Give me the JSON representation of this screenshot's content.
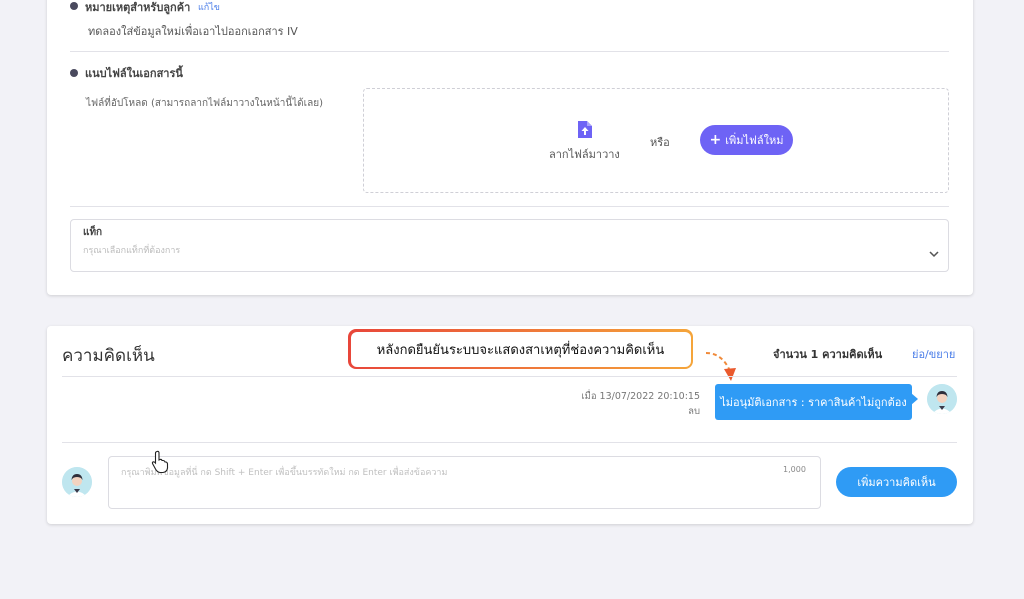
{
  "customer_note": {
    "title": "หมายเหตุสำหรับลูกค้า",
    "edit_label": "แก้ไข",
    "text": "ทดลองใส่ข้อมูลใหม่เพื่อเอาไปออกเอกสาร IV"
  },
  "attachments": {
    "title": "แนบไฟล์ในเอกสารนี้",
    "hint": "ไฟล์ที่อัปโหลด (สามารถลากไฟล์มาวางในหน้านี้ได้เลย)",
    "drag_label": "ลากไฟล์มาวาง",
    "or_label": "หรือ",
    "add_button": "เพิ่มไฟล์ใหม่"
  },
  "tag": {
    "label": "แท็ก",
    "placeholder": "กรุณาเลือกแท็กที่ต้องการ"
  },
  "comments": {
    "title": "ความคิดเห็น",
    "callout": "หลังกดยืนยันระบบจะแสดงสาเหตุที่ช่องความคิดเห็น",
    "count": "จำนวน 1 ความคิดเห็น",
    "collapse_label": "ย่อ/ขยาย",
    "items": [
      {
        "timestamp": "เมื่อ 13/07/2022 20:10:15",
        "delete_label": "ลบ",
        "message": "ไม่อนุมัติเอกสาร : ราคาสินค้าไม่ถูกต้อง"
      }
    ],
    "input_placeholder": "กรุณาพิมพ์ข้อมูลที่นี่ กด Shift + Enter เพื่อขึ้นบรรทัดใหม่ กด Enter เพื่อส่งข้อความ",
    "char_limit": "1,000",
    "submit_button": "เพิ่มความคิดเห็น"
  },
  "colors": {
    "primary_button": "#6e63f5",
    "comment_bubble": "#2f9bf5",
    "callout_gradient_start": "#e8463a",
    "callout_gradient_end": "#f5a53a",
    "link": "#4a7de8"
  }
}
